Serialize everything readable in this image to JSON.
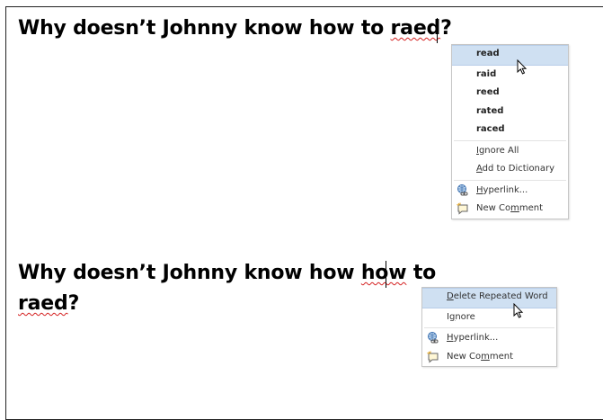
{
  "sentence1": {
    "prefix": "Why doesn’t Johnny know how to ",
    "misspelled": "raed",
    "suffix": "?"
  },
  "menu1": {
    "suggestions": [
      "read",
      "raid",
      "reed",
      "rated",
      "raced"
    ],
    "ignore_all": {
      "pre": "",
      "key": "I",
      "post": "gnore All"
    },
    "add_to_dictionary": {
      "pre": "",
      "key": "A",
      "post": "dd to Dictionary"
    },
    "hyperlink": {
      "pre": "",
      "key": "H",
      "post": "yperlink..."
    },
    "new_comment": {
      "pre": "New Co",
      "key": "m",
      "post": "ment"
    }
  },
  "sentence2": {
    "prefix": "Why doesn’t Johnny know how ",
    "repeated": "how",
    "suffix": " to",
    "line2_word": "raed",
    "line2_suffix": "?"
  },
  "menu2": {
    "delete_repeated": {
      "pre": "",
      "key": "D",
      "post": "elete Repeated Word"
    },
    "ignore": {
      "pre": "I",
      "key": "g",
      "post": "nore"
    },
    "hyperlink": {
      "pre": "",
      "key": "H",
      "post": "yperlink..."
    },
    "new_comment": {
      "pre": "New Co",
      "key": "m",
      "post": "ment"
    }
  },
  "icons": {
    "hyperlink": "globe-link-icon",
    "new_comment": "new-comment-icon",
    "pointer": "mouse-pointer-icon"
  },
  "colors": {
    "spelling_squiggle": "#d42020",
    "menu_highlight": "#cfe0f2",
    "menu_border": "#c6c6c6"
  }
}
